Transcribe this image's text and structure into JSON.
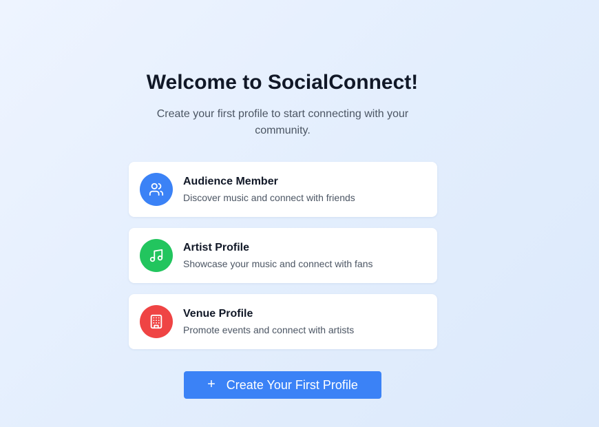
{
  "header": {
    "title": "Welcome to SocialConnect!",
    "subtitle": "Create your first profile to start connecting with your community."
  },
  "profile_types": [
    {
      "title": "Audience Member",
      "description": "Discover music and connect with friends",
      "icon": "users-icon",
      "color": "#3b82f6"
    },
    {
      "title": "Artist Profile",
      "description": "Showcase your music and connect with fans",
      "icon": "music-note-icon",
      "color": "#22c55e"
    },
    {
      "title": "Venue Profile",
      "description": "Promote events and connect with artists",
      "icon": "building-icon",
      "color": "#ef4444"
    }
  ],
  "actions": {
    "create_label": "Create Your First Profile",
    "create_icon": "plus-icon",
    "accent": "#3b82f6"
  }
}
